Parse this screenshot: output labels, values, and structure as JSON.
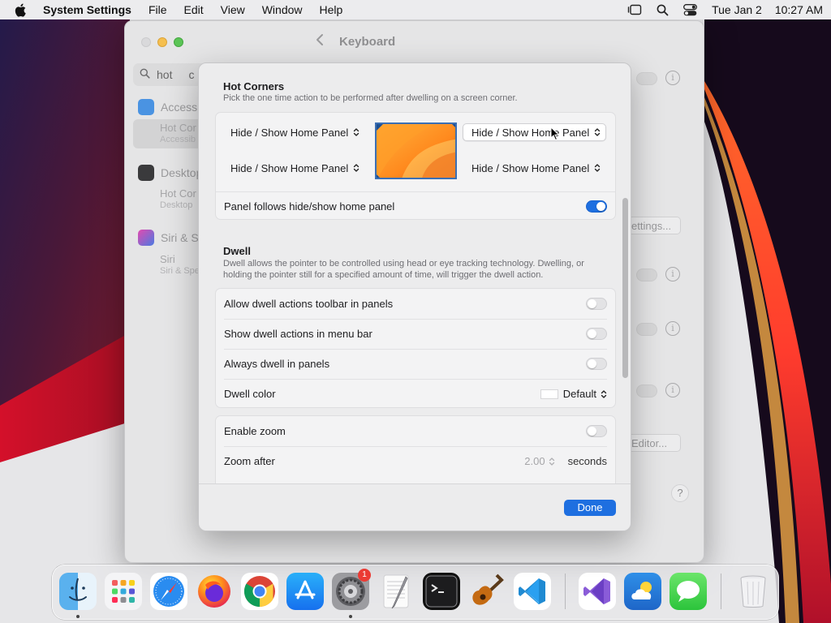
{
  "menubar": {
    "app_name": "System Settings",
    "items": [
      "File",
      "Edit",
      "View",
      "Window",
      "Help"
    ],
    "date": "Tue Jan 2",
    "time": "10:27 AM"
  },
  "settings_window": {
    "title": "Keyboard",
    "search_value": "hot",
    "search_extra": "c",
    "sidebar": [
      {
        "label": "Accessi",
        "sub1": "Hot Cor",
        "sub2": "Accessib"
      },
      {
        "label": "Desktop",
        "sub1": "Hot Cor",
        "sub2": "Desktop"
      },
      {
        "label": "Siri & Sp",
        "sub1": "Siri",
        "sub2": "Siri & Spe"
      }
    ],
    "bg_buttons": {
      "settings": "ettings...",
      "editor": "Editor..."
    },
    "help": "?"
  },
  "sheet": {
    "hot_corners": {
      "title": "Hot Corners",
      "description": "Pick the one time action to be performed after dwelling on a screen corner.",
      "top_left": "Hide / Show Home Panel",
      "top_right": "Hide / Show Home Panel",
      "bottom_left": "Hide / Show Home Panel",
      "bottom_right": "Hide / Show Home Panel",
      "follows_label": "Panel follows hide/show home panel",
      "follows_on": true
    },
    "dwell": {
      "title": "Dwell",
      "description": "Dwell allows the pointer to be controlled using head or eye tracking technology. Dwelling, or holding the pointer still for a specified amount of time, will trigger the dwell action.",
      "rows": [
        {
          "label": "Allow dwell actions toolbar in panels",
          "on": false
        },
        {
          "label": "Show dwell actions in menu bar",
          "on": false
        },
        {
          "label": "Always dwell in panels",
          "on": false
        }
      ],
      "color_label": "Dwell color",
      "color_value": "Default"
    },
    "zoom": {
      "enable_label": "Enable zoom",
      "enable_on": false,
      "after_label": "Zoom after",
      "after_value": "2.00",
      "after_unit": "seconds"
    },
    "done_label": "Done"
  },
  "dock": {
    "apps": [
      "Finder",
      "Launchpad",
      "Safari",
      "Firefox",
      "Chrome",
      "App Store",
      "System Settings",
      "TextEdit",
      "Terminal",
      "Instruments",
      "Visual Studio Code",
      "Visual Studio",
      "Weather",
      "Messages",
      "Trash"
    ],
    "settings_badge": "1"
  },
  "colors": {
    "accent": "#1e6fe0",
    "badge": "#ec3b34"
  }
}
